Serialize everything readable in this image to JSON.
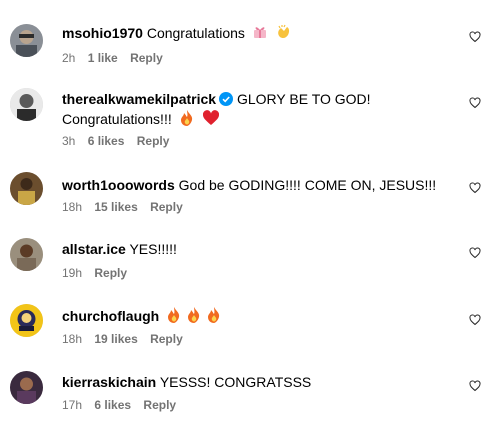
{
  "comments": [
    {
      "username": "msohio1970",
      "text": "Congratulations",
      "emojis": [
        "ribbon-emoji",
        "clapping-hands-emoji"
      ],
      "time": "2h",
      "likes": "1 like",
      "reply": "Reply",
      "verified": false
    },
    {
      "username": "therealkwamekilpatrick",
      "text": "GLORY BE TO GOD!",
      "text2": "Congratulations!!!",
      "emojis": [
        "fire-emoji",
        "red-heart-emoji"
      ],
      "time": "3h",
      "likes": "6 likes",
      "reply": "Reply",
      "verified": true
    },
    {
      "username": "worth1ooowords",
      "text": "God be GODING!!!! COME ON, JESUS!!!",
      "emojis": [],
      "time": "18h",
      "likes": "15 likes",
      "reply": "Reply",
      "verified": false
    },
    {
      "username": "allstar.ice",
      "text": "YES!!!!!",
      "emojis": [],
      "time": "19h",
      "likes": "",
      "reply": "Reply",
      "verified": false
    },
    {
      "username": "churchoflaugh",
      "text": "",
      "emojis": [
        "fire-emoji",
        "fire-emoji",
        "fire-emoji"
      ],
      "time": "18h",
      "likes": "19 likes",
      "reply": "Reply",
      "verified": false
    },
    {
      "username": "kierraskichain",
      "text": "YESSS! CONGRATSSS",
      "emojis": [],
      "time": "17h",
      "likes": "6 likes",
      "reply": "Reply",
      "verified": false
    }
  ],
  "colors": {
    "meta_gray": "#737373",
    "verified_blue": "#0095f6",
    "heart_stroke": "#262626"
  }
}
